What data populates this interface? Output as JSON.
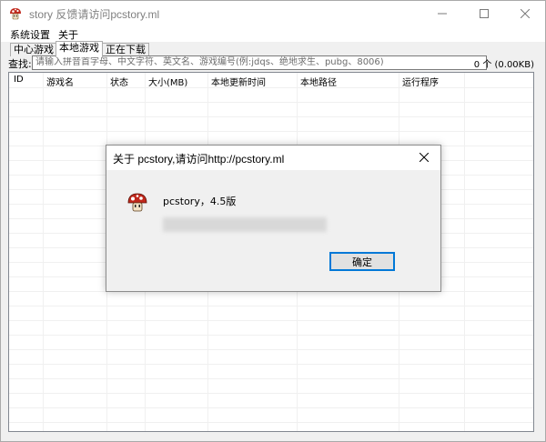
{
  "window": {
    "title": "story 反馈请访问pcstory.ml",
    "controls": {
      "minimize_icon": "minimize-icon",
      "maximize_icon": "maximize-icon",
      "close_icon": "close-icon"
    },
    "accent_color": "#0078d7"
  },
  "menu": {
    "items": [
      "系统设置",
      "关于"
    ]
  },
  "tabs": [
    {
      "label": "中心游戏",
      "active": false
    },
    {
      "label": "本地游戏",
      "active": true
    },
    {
      "label": "正在下载",
      "active": false
    }
  ],
  "search": {
    "label": "查找:",
    "placeholder": "请输入拼音首字母、中文字符、英文名、游戏编号(例:jdqs、绝地求生、pubg、8006)",
    "count": "0 个 (0.00KB)"
  },
  "list": {
    "columns": [
      "ID",
      "游戏名",
      "状态",
      "大小(MB)",
      "本地更新时间",
      "本地路径",
      "运行程序"
    ],
    "rows": []
  },
  "dialog": {
    "title": "关于 pcstory,请访问http://pcstory.ml",
    "version_text": "pcstory，4.5版",
    "ok_label": "确定",
    "icon": "mushroom-icon"
  }
}
